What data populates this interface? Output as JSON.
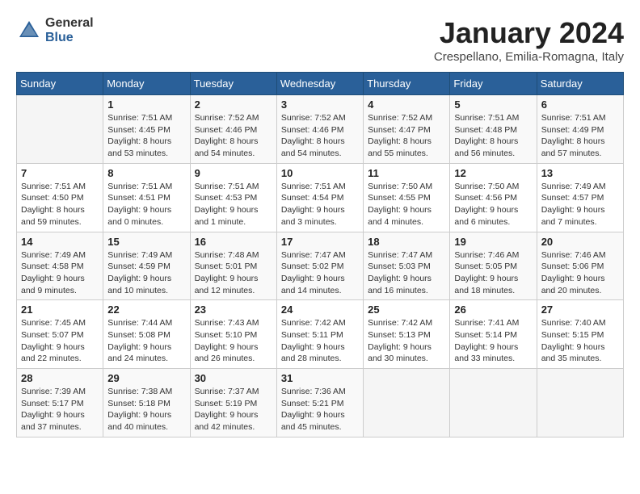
{
  "logo": {
    "general": "General",
    "blue": "Blue"
  },
  "title": "January 2024",
  "location": "Crespellano, Emilia-Romagna, Italy",
  "days_header": [
    "Sunday",
    "Monday",
    "Tuesday",
    "Wednesday",
    "Thursday",
    "Friday",
    "Saturday"
  ],
  "weeks": [
    [
      {
        "num": "",
        "sunrise": "",
        "sunset": "",
        "daylight": "",
        "empty": true
      },
      {
        "num": "1",
        "sunrise": "Sunrise: 7:51 AM",
        "sunset": "Sunset: 4:45 PM",
        "daylight": "Daylight: 8 hours and 53 minutes."
      },
      {
        "num": "2",
        "sunrise": "Sunrise: 7:52 AM",
        "sunset": "Sunset: 4:46 PM",
        "daylight": "Daylight: 8 hours and 54 minutes."
      },
      {
        "num": "3",
        "sunrise": "Sunrise: 7:52 AM",
        "sunset": "Sunset: 4:46 PM",
        "daylight": "Daylight: 8 hours and 54 minutes."
      },
      {
        "num": "4",
        "sunrise": "Sunrise: 7:52 AM",
        "sunset": "Sunset: 4:47 PM",
        "daylight": "Daylight: 8 hours and 55 minutes."
      },
      {
        "num": "5",
        "sunrise": "Sunrise: 7:51 AM",
        "sunset": "Sunset: 4:48 PM",
        "daylight": "Daylight: 8 hours and 56 minutes."
      },
      {
        "num": "6",
        "sunrise": "Sunrise: 7:51 AM",
        "sunset": "Sunset: 4:49 PM",
        "daylight": "Daylight: 8 hours and 57 minutes."
      }
    ],
    [
      {
        "num": "7",
        "sunrise": "Sunrise: 7:51 AM",
        "sunset": "Sunset: 4:50 PM",
        "daylight": "Daylight: 8 hours and 59 minutes."
      },
      {
        "num": "8",
        "sunrise": "Sunrise: 7:51 AM",
        "sunset": "Sunset: 4:51 PM",
        "daylight": "Daylight: 9 hours and 0 minutes."
      },
      {
        "num": "9",
        "sunrise": "Sunrise: 7:51 AM",
        "sunset": "Sunset: 4:53 PM",
        "daylight": "Daylight: 9 hours and 1 minute."
      },
      {
        "num": "10",
        "sunrise": "Sunrise: 7:51 AM",
        "sunset": "Sunset: 4:54 PM",
        "daylight": "Daylight: 9 hours and 3 minutes."
      },
      {
        "num": "11",
        "sunrise": "Sunrise: 7:50 AM",
        "sunset": "Sunset: 4:55 PM",
        "daylight": "Daylight: 9 hours and 4 minutes."
      },
      {
        "num": "12",
        "sunrise": "Sunrise: 7:50 AM",
        "sunset": "Sunset: 4:56 PM",
        "daylight": "Daylight: 9 hours and 6 minutes."
      },
      {
        "num": "13",
        "sunrise": "Sunrise: 7:49 AM",
        "sunset": "Sunset: 4:57 PM",
        "daylight": "Daylight: 9 hours and 7 minutes."
      }
    ],
    [
      {
        "num": "14",
        "sunrise": "Sunrise: 7:49 AM",
        "sunset": "Sunset: 4:58 PM",
        "daylight": "Daylight: 9 hours and 9 minutes."
      },
      {
        "num": "15",
        "sunrise": "Sunrise: 7:49 AM",
        "sunset": "Sunset: 4:59 PM",
        "daylight": "Daylight: 9 hours and 10 minutes."
      },
      {
        "num": "16",
        "sunrise": "Sunrise: 7:48 AM",
        "sunset": "Sunset: 5:01 PM",
        "daylight": "Daylight: 9 hours and 12 minutes."
      },
      {
        "num": "17",
        "sunrise": "Sunrise: 7:47 AM",
        "sunset": "Sunset: 5:02 PM",
        "daylight": "Daylight: 9 hours and 14 minutes."
      },
      {
        "num": "18",
        "sunrise": "Sunrise: 7:47 AM",
        "sunset": "Sunset: 5:03 PM",
        "daylight": "Daylight: 9 hours and 16 minutes."
      },
      {
        "num": "19",
        "sunrise": "Sunrise: 7:46 AM",
        "sunset": "Sunset: 5:05 PM",
        "daylight": "Daylight: 9 hours and 18 minutes."
      },
      {
        "num": "20",
        "sunrise": "Sunrise: 7:46 AM",
        "sunset": "Sunset: 5:06 PM",
        "daylight": "Daylight: 9 hours and 20 minutes."
      }
    ],
    [
      {
        "num": "21",
        "sunrise": "Sunrise: 7:45 AM",
        "sunset": "Sunset: 5:07 PM",
        "daylight": "Daylight: 9 hours and 22 minutes."
      },
      {
        "num": "22",
        "sunrise": "Sunrise: 7:44 AM",
        "sunset": "Sunset: 5:08 PM",
        "daylight": "Daylight: 9 hours and 24 minutes."
      },
      {
        "num": "23",
        "sunrise": "Sunrise: 7:43 AM",
        "sunset": "Sunset: 5:10 PM",
        "daylight": "Daylight: 9 hours and 26 minutes."
      },
      {
        "num": "24",
        "sunrise": "Sunrise: 7:42 AM",
        "sunset": "Sunset: 5:11 PM",
        "daylight": "Daylight: 9 hours and 28 minutes."
      },
      {
        "num": "25",
        "sunrise": "Sunrise: 7:42 AM",
        "sunset": "Sunset: 5:13 PM",
        "daylight": "Daylight: 9 hours and 30 minutes."
      },
      {
        "num": "26",
        "sunrise": "Sunrise: 7:41 AM",
        "sunset": "Sunset: 5:14 PM",
        "daylight": "Daylight: 9 hours and 33 minutes."
      },
      {
        "num": "27",
        "sunrise": "Sunrise: 7:40 AM",
        "sunset": "Sunset: 5:15 PM",
        "daylight": "Daylight: 9 hours and 35 minutes."
      }
    ],
    [
      {
        "num": "28",
        "sunrise": "Sunrise: 7:39 AM",
        "sunset": "Sunset: 5:17 PM",
        "daylight": "Daylight: 9 hours and 37 minutes."
      },
      {
        "num": "29",
        "sunrise": "Sunrise: 7:38 AM",
        "sunset": "Sunset: 5:18 PM",
        "daylight": "Daylight: 9 hours and 40 minutes."
      },
      {
        "num": "30",
        "sunrise": "Sunrise: 7:37 AM",
        "sunset": "Sunset: 5:19 PM",
        "daylight": "Daylight: 9 hours and 42 minutes."
      },
      {
        "num": "31",
        "sunrise": "Sunrise: 7:36 AM",
        "sunset": "Sunset: 5:21 PM",
        "daylight": "Daylight: 9 hours and 45 minutes."
      },
      {
        "num": "",
        "sunrise": "",
        "sunset": "",
        "daylight": "",
        "empty": true
      },
      {
        "num": "",
        "sunrise": "",
        "sunset": "",
        "daylight": "",
        "empty": true
      },
      {
        "num": "",
        "sunrise": "",
        "sunset": "",
        "daylight": "",
        "empty": true
      }
    ]
  ]
}
